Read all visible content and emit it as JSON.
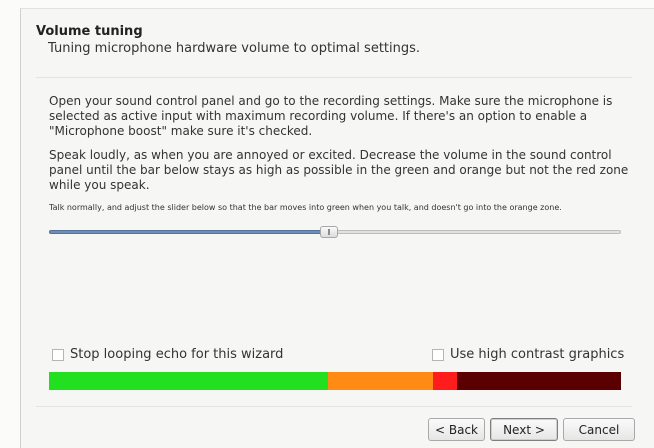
{
  "header": {
    "title": "Volume tuning",
    "subtitle": "Tuning microphone hardware volume to optimal settings."
  },
  "instructions": {
    "para1": "Open your sound control panel and go to the recording settings. Make sure the microphone is selected as active input with maximum recording volume. If there's an option to enable a \"Microphone boost\" make sure it's checked.",
    "para2": "Speak loudly, as when you are annoyed or excited. Decrease the volume in the sound control panel until the bar below stays as high as possible in the green and orange but not the red zone while you speak.",
    "hint": "Talk normally, and adjust the slider below so that the bar moves into green when you talk, and doesn't go into the orange zone."
  },
  "slider": {
    "value_fraction": 0.49
  },
  "checkboxes": {
    "stop_echo": {
      "label": "Stop looping echo for this wizard",
      "checked": false
    },
    "high_contrast": {
      "label": "Use high contrast graphics",
      "checked": false
    }
  },
  "level_meter": {
    "zones": [
      {
        "name": "green",
        "fraction": 0.487,
        "color": "#22e01f"
      },
      {
        "name": "orange",
        "fraction": 0.184,
        "color": "#ff8a14"
      },
      {
        "name": "red",
        "fraction": 0.043,
        "color": "#ff1c1c"
      },
      {
        "name": "dark-red",
        "fraction": 0.286,
        "color": "#5a0000"
      }
    ]
  },
  "buttons": {
    "back": "< Back",
    "next": "Next >",
    "cancel": "Cancel"
  }
}
